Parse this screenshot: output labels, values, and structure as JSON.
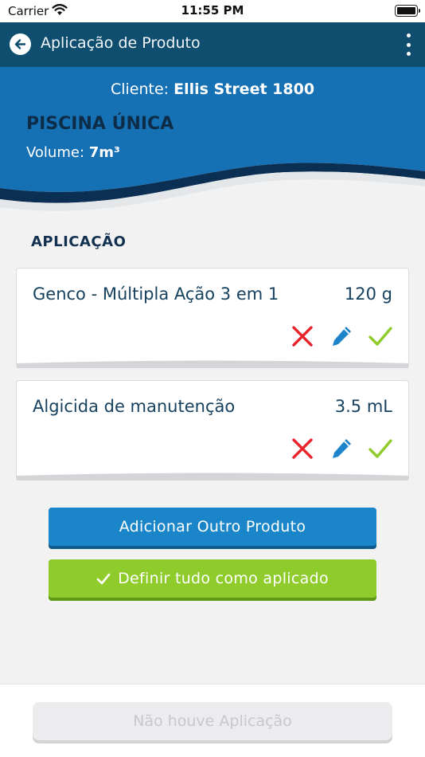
{
  "status_bar": {
    "carrier": "Carrier",
    "time": "11:55 PM"
  },
  "app_bar": {
    "title": "Aplicação de Produto",
    "back_icon": "arrow-left-circle-icon",
    "menu_icon": "more-vertical-icon"
  },
  "pool": {
    "client_label": "Cliente:",
    "client_name": "Ellis Street 1800",
    "name": "PISCINA ÚNICA",
    "volume_label": "Volume:",
    "volume_value": "7m³"
  },
  "section_title": "APLICAÇÃO",
  "products": [
    {
      "name": "Genco - Múltipla Ação 3 em 1",
      "quantity": "120 g"
    },
    {
      "name": "Algicida de manutenção",
      "quantity": "3.5 mL"
    }
  ],
  "buttons": {
    "add_product": "Adicionar Outro Produto",
    "set_all_applied": "Definir tudo como aplicado",
    "no_application": "Não houve Aplicação"
  },
  "colors": {
    "header_dark": "#0f4e6e",
    "hero_blue": "#1670b4",
    "primary_button": "#1a86c9",
    "success_button": "#8ecb2b",
    "delete_red": "#e8232b",
    "edit_blue": "#1d84c9",
    "confirm_green": "#8ecb2b"
  }
}
